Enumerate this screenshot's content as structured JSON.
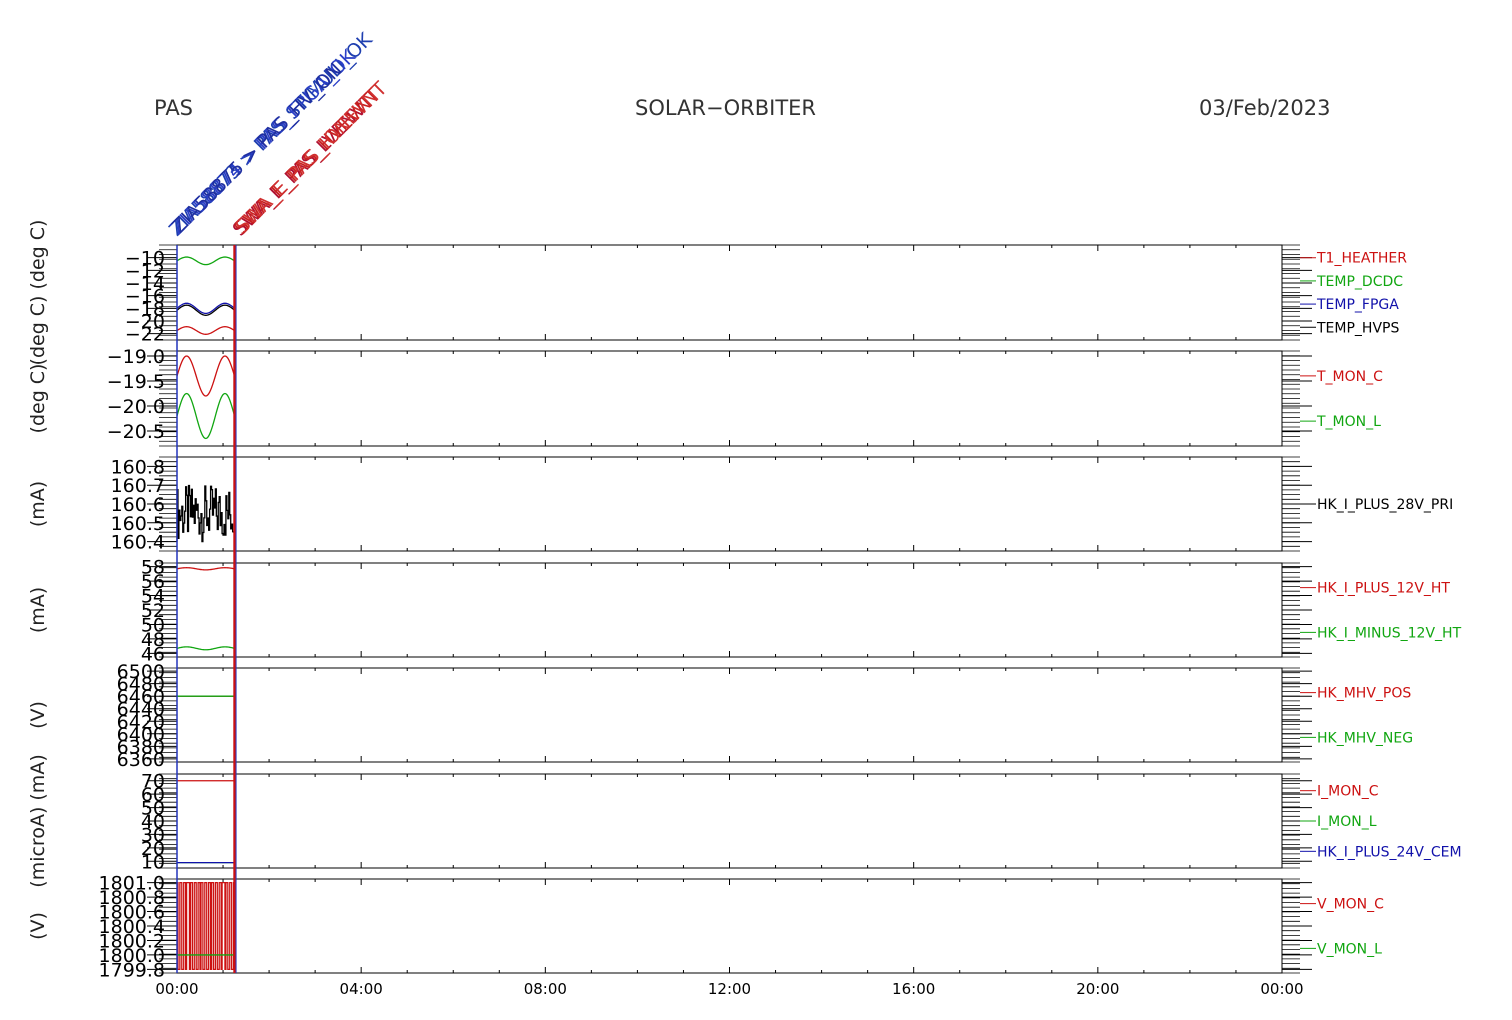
{
  "header": {
    "left": "PAS",
    "center": "SOLAR−ORBITER",
    "right": "03/Feb/2023"
  },
  "events": [
    {
      "text": "ZIA58873 > PAS_STIMULI_OK",
      "color": "#1f3fb0"
    },
    {
      "text": "ZIA58874 > PAS_FPGA_OK",
      "color": "#2b3fc8"
    },
    {
      "text": "ZIA58875 > PAS_HV_ON",
      "color": "#1f2fa0"
    },
    {
      "text": "SWA_E_PAS_LVENVT",
      "color": "#b01030"
    },
    {
      "text": "SWA_E_PAS_HVEVNT",
      "color": "#c82020"
    },
    {
      "text": "SWA_E_PAS_IONEVNT",
      "color": "#d03030"
    }
  ],
  "colors": {
    "red": "#cc1111",
    "green": "#11a611",
    "blue": "#1111aa",
    "black": "#000000",
    "marker_red": "#cc1111",
    "marker_blue": "#2233bb"
  },
  "chart_data": {
    "type": "line",
    "x_label": "",
    "x_range": [
      "00:00",
      "24:00"
    ],
    "x_ticks": [
      "00:00",
      "04:00",
      "08:00",
      "12:00",
      "16:00",
      "20:00",
      "00:00"
    ],
    "data_end": "01:15",
    "panels": [
      {
        "unit": "(deg C)  (deg C)",
        "ylim": [
          -23,
          -8
        ],
        "y_ticks": [
          "−10",
          "−12",
          "−14",
          "−16",
          "−18",
          "−20",
          "−22"
        ],
        "series": [
          {
            "name": "T1_HEATHER",
            "color": "red",
            "base": -21.5,
            "amp": 0.6
          },
          {
            "name": "TEMP_DCDC",
            "color": "green",
            "base": -10.5,
            "amp": 0.6
          },
          {
            "name": "TEMP_FPGA",
            "color": "blue",
            "base": -18.0,
            "amp": 0.8
          },
          {
            "name": "TEMP_HVPS",
            "color": "black",
            "base": -18.3,
            "amp": 0.8
          }
        ]
      },
      {
        "unit": "(deg C)",
        "ylim": [
          -20.8,
          -18.9
        ],
        "y_ticks": [
          "−19.0",
          "−19.5",
          "−20.0",
          "−20.5"
        ],
        "series": [
          {
            "name": "T_MON_C",
            "color": "red",
            "base": -19.4,
            "amp": 0.4
          },
          {
            "name": "T_MON_L",
            "color": "green",
            "base": -20.2,
            "amp": 0.45
          }
        ]
      },
      {
        "unit": "(mA)",
        "ylim": [
          160.35,
          160.85
        ],
        "y_ticks": [
          "160.8",
          "160.7",
          "160.6",
          "160.5",
          "160.4"
        ],
        "series": [
          {
            "name": "HK_I_PLUS_28V_PRI",
            "color": "black",
            "base": 160.55,
            "amp": 0.15,
            "noisy": true
          }
        ]
      },
      {
        "unit": "(mA)",
        "ylim": [
          45.5,
          58.5
        ],
        "y_ticks": [
          "58",
          "56",
          "54",
          "52",
          "50",
          "48",
          "46"
        ],
        "series": [
          {
            "name": "HK_I_PLUS_12V_HT",
            "color": "red",
            "base": 57.7,
            "amp": 0.15
          },
          {
            "name": "HK_I_MINUS_12V_HT",
            "color": "green",
            "base": 46.7,
            "amp": 0.2
          }
        ]
      },
      {
        "unit": "(V)",
        "ylim": [
          6355,
          6505
        ],
        "y_ticks": [
          "6500",
          "6480",
          "6460",
          "6440",
          "6420",
          "6400",
          "6380",
          "6360"
        ],
        "series": [
          {
            "name": "HK_MHV_POS",
            "color": "red",
            "base": 6460,
            "amp": 0
          },
          {
            "name": "HK_MHV_NEG",
            "color": "green",
            "base": 6460,
            "amp": 0
          }
        ]
      },
      {
        "unit": "(microA)  (mA)",
        "ylim": [
          5,
          75
        ],
        "y_ticks": [
          "70",
          "60",
          "50",
          "40",
          "30",
          "20",
          "10"
        ],
        "series": [
          {
            "name": "I_MON_C",
            "color": "red",
            "base": 70,
            "amp": 0
          },
          {
            "name": "I_MON_L",
            "color": "green",
            "base": 9,
            "amp": 0
          },
          {
            "name": "HK_I_PLUS_24V_CEM",
            "color": "blue",
            "base": 9,
            "amp": 0
          }
        ]
      },
      {
        "unit": "(V)",
        "ylim": [
          1799.75,
          1801.05
        ],
        "y_ticks": [
          "1801.0",
          "1800.8",
          "1800.6",
          "1800.4",
          "1800.2",
          "1800.0",
          "1799.8"
        ],
        "series": [
          {
            "name": "V_MON_C",
            "color": "red",
            "base": 1800.4,
            "amp": 0.6,
            "square": true
          },
          {
            "name": "V_MON_L",
            "color": "green",
            "base": 1800.0,
            "amp": 0
          }
        ]
      }
    ]
  }
}
